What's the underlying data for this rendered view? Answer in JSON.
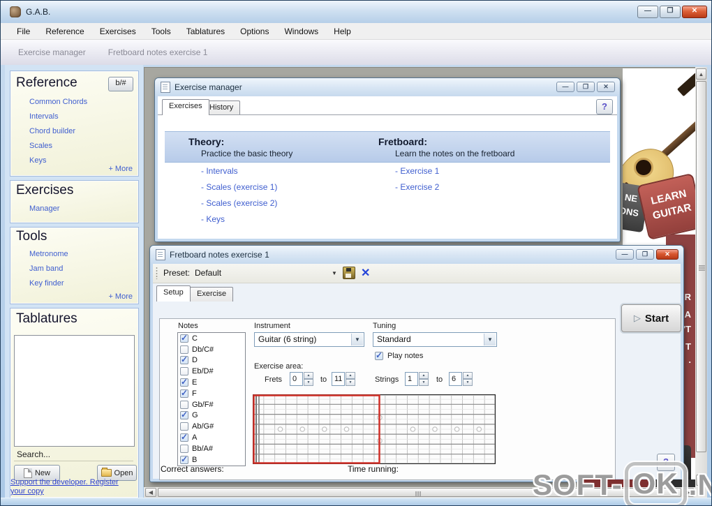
{
  "titlebar": {
    "title": "G.A.B.",
    "minimize": "—",
    "maximize": "❐",
    "close": "✕"
  },
  "menu": {
    "items": [
      "File",
      "Reference",
      "Exercises",
      "Tools",
      "Tablatures",
      "Options",
      "Windows",
      "Help"
    ]
  },
  "tabstrip": {
    "tabs": [
      "Exercise manager",
      "Fretboard notes exercise 1"
    ]
  },
  "sidebar": {
    "reference": {
      "title": "Reference",
      "accidental_button": "b/#",
      "links": [
        "Common Chords",
        "Intervals",
        "Chord builder",
        "Scales",
        "Keys"
      ],
      "more": "+ More"
    },
    "exercises": {
      "title": "Exercises",
      "links": [
        "Manager"
      ]
    },
    "tools": {
      "title": "Tools",
      "links": [
        "Metronome",
        "Jam band",
        "Key finder"
      ],
      "more": "+ More"
    },
    "tablatures": {
      "title": "Tablatures",
      "search": "Search...",
      "new_label": "New",
      "open_label": "Open"
    },
    "register_line1": "Support the developer. Register",
    "register_line2": "your copy"
  },
  "em": {
    "title": "Exercise manager",
    "help": "?",
    "tabs": [
      "Exercises",
      "History"
    ],
    "theory_heading": "Theory:",
    "theory_sub": "Practice the basic theory",
    "theory_links": [
      "- Intervals",
      "- Scales (exercise 1)",
      "- Scales (exercise 2)",
      "- Keys"
    ],
    "fret_heading": "Fretboard:",
    "fret_sub": "Learn the notes on the fretboard",
    "fret_links": [
      "- Exercise 1",
      "- Exercise 2"
    ],
    "minimize": "—",
    "maximize": "❐",
    "close": "✕"
  },
  "fb": {
    "title": "Fretboard notes exercise 1",
    "minimize": "—",
    "maximize": "❐",
    "close": "✕",
    "preset_label": "Preset:",
    "preset_value": "Default",
    "tabs": [
      "Setup",
      "Exercise"
    ],
    "start_label": "Start",
    "notes_label": "Notes",
    "notes": [
      {
        "label": "C",
        "checked": true
      },
      {
        "label": "Db/C#",
        "checked": false
      },
      {
        "label": "D",
        "checked": true
      },
      {
        "label": "Eb/D#",
        "checked": false
      },
      {
        "label": "E",
        "checked": true
      },
      {
        "label": "F",
        "checked": true
      },
      {
        "label": "Gb/F#",
        "checked": false
      },
      {
        "label": "G",
        "checked": true
      },
      {
        "label": "Ab/G#",
        "checked": false
      },
      {
        "label": "A",
        "checked": true
      },
      {
        "label": "Bb/A#",
        "checked": false
      },
      {
        "label": "B",
        "checked": true
      }
    ],
    "instrument_label": "Instrument",
    "instrument_value": "Guitar (6 string)",
    "tuning_label": "Tuning",
    "tuning_value": "Standard",
    "play_notes_label": "Play notes",
    "play_notes_checked": true,
    "area_label": "Exercise area:",
    "frets_label": "Frets",
    "frets_from": "0",
    "to_word": "to",
    "frets_to": "11",
    "strings_label": "Strings",
    "strings_from": "1",
    "strings_to": "6",
    "status_left": "Correct answers:",
    "status_right": "Time running:",
    "help": "?"
  },
  "ad": {
    "key_dark_line1": "NE",
    "key_dark_line2": "ONS",
    "key_red_line1": "LEARN",
    "key_red_line2": "GUITAR",
    "strip_fragments": [
      "R",
      "A",
      "'T",
      "T",
      "."
    ]
  },
  "watermark": {
    "part1": "SOFT-",
    "part2": "OK",
    "part3": ".NET"
  },
  "colors": {
    "aero_blue": "#b6cfe8",
    "panel_yellow": "#f6f6e2",
    "link_blue": "#3f5ecf",
    "banner_blue": "#c3d4ec",
    "mdi_grey": "#a7a7a0",
    "close_red": "#c9431f",
    "exercise_area_red": "#d03028",
    "strip_red": "#8d4242"
  }
}
